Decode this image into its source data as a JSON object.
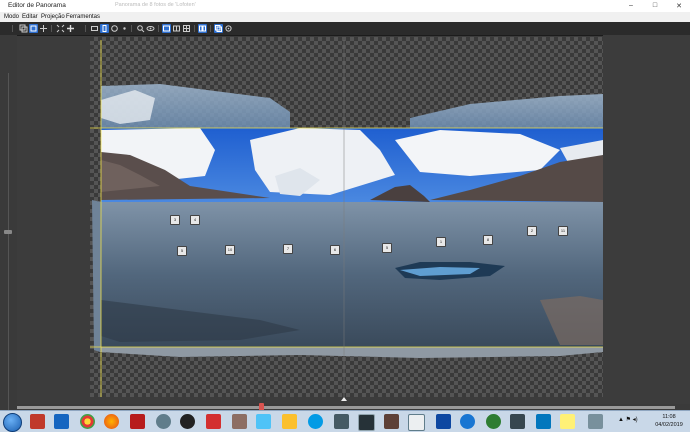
{
  "window": {
    "title": "Editor de Panorama",
    "background_tab": "Panorama de 8 fotos de 'Lofoten'",
    "controls": [
      "–",
      "□",
      "✕"
    ]
  },
  "menu": [
    "Modo",
    "Editar",
    "Projeção",
    "Ferramentas"
  ],
  "toolbar": {
    "groups": [
      [
        "layers-icon",
        "crop-select-icon",
        "move-icon"
      ],
      [
        "fit-icon",
        "add-icon"
      ],
      [
        "rect-icon",
        "crop-icon",
        "lasso-icon",
        "dot-icon"
      ],
      [
        "zoom-icon",
        "eye-icon"
      ],
      [
        "view-single-icon",
        "view-split-icon",
        "grid-icon"
      ],
      [
        "columns-icon"
      ],
      [
        "layers-stack-icon",
        "settings-icon"
      ]
    ]
  },
  "control_points": [
    "3",
    "4",
    "5",
    "10",
    "7",
    "6",
    "5",
    "1",
    "8",
    "2",
    "11"
  ],
  "taskbar": {
    "apps": [
      "chrome",
      "firefox",
      "filezilla",
      "settings",
      "outlook",
      "vlc",
      "skype",
      "lightroom",
      "photoshop",
      "pdf",
      "edge"
    ],
    "tray_symbols": "▲ ⚑ ◂)",
    "clock_time": "11:08",
    "clock_date": "04/02/2019"
  },
  "colors": {
    "accent": "#2d6fd1",
    "guide": "#f0e24a",
    "titlebar": "#ffffff",
    "canvas": "#3a3a3a"
  }
}
